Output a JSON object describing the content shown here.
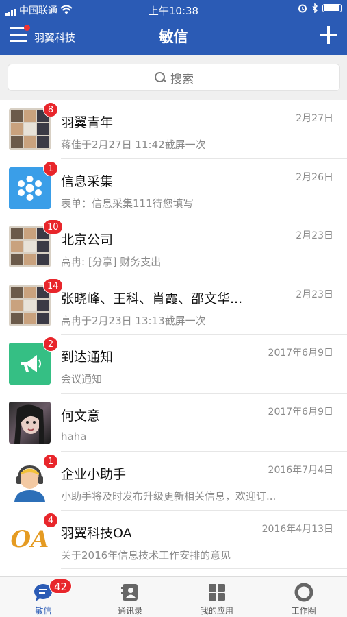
{
  "status_bar": {
    "carrier": "中国联通",
    "time": "上午10:38"
  },
  "header": {
    "org_name": "羽翼科技",
    "title": "敏信"
  },
  "search": {
    "placeholder": "搜索"
  },
  "conversations": [
    {
      "title": "羽翼青年",
      "subtitle": "蒋佳于2月27日 11:42截屏一次",
      "date": "2月27日",
      "badge": "8",
      "avatar": "group"
    },
    {
      "title": "信息采集",
      "subtitle": "表单：信息采集111待您填写",
      "date": "2月26日",
      "badge": "1",
      "avatar": "info"
    },
    {
      "title": "北京公司",
      "subtitle": "高冉: [分享] 财务支出",
      "date": "2月23日",
      "badge": "10",
      "avatar": "group"
    },
    {
      "title": "张晓峰、王科、肖霞、邵文华...",
      "subtitle": "高冉于2月23日 13:13截屏一次",
      "date": "2月23日",
      "badge": "14",
      "avatar": "group"
    },
    {
      "title": "到达通知",
      "subtitle": "会议通知",
      "date": "2017年6月9日",
      "badge": "2",
      "avatar": "notice"
    },
    {
      "title": "何文意",
      "subtitle": "haha",
      "date": "2017年6月9日",
      "badge": "",
      "avatar": "photo"
    },
    {
      "title": "企业小助手",
      "subtitle": "小助手将及时发布升级更新相关信息，欢迎订...",
      "date": "2016年7月4日",
      "badge": "1",
      "avatar": "helper"
    },
    {
      "title": "羽翼科技OA",
      "subtitle": "关于2016年信息技术工作安排的意见",
      "date": "2016年4月13日",
      "badge": "4",
      "avatar": "oa",
      "avatar_text": "OA"
    }
  ],
  "tabbar": {
    "tabs": [
      {
        "label": "敏信",
        "badge": "42",
        "icon": "chat-icon"
      },
      {
        "label": "通讯录",
        "icon": "contacts-icon"
      },
      {
        "label": "我的应用",
        "icon": "apps-grid-icon"
      },
      {
        "label": "工作圈",
        "icon": "circle-icon"
      }
    ]
  },
  "colors": {
    "header_bg": "#2b5bb5",
    "badge": "#e8262b",
    "active_tab": "#2b5bb5"
  }
}
